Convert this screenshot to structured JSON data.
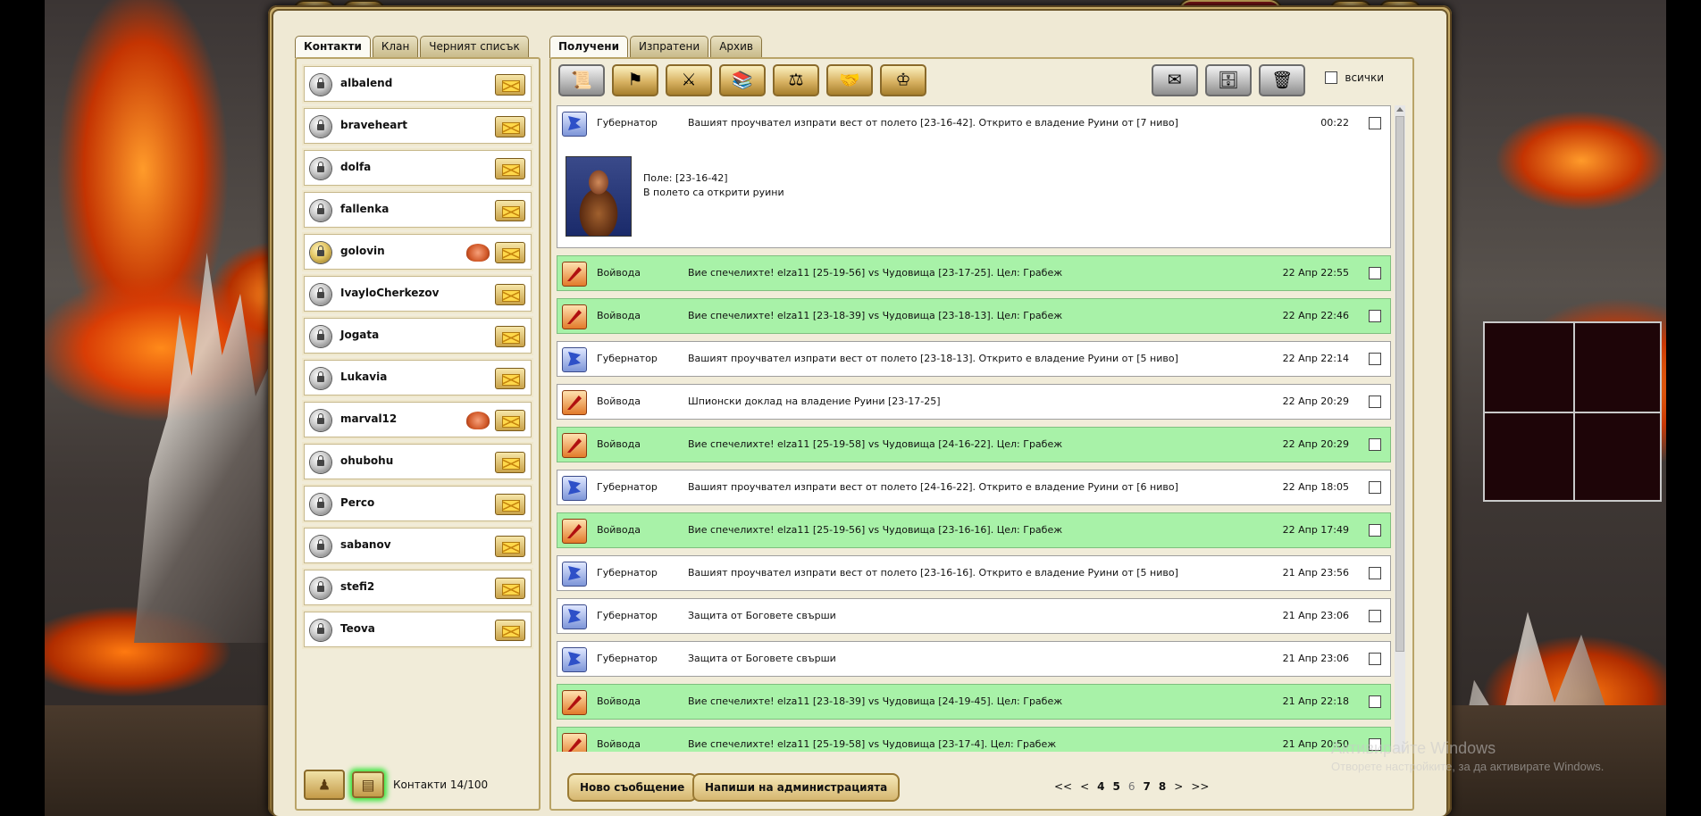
{
  "left_tabs": [
    "Контакти",
    "Клан",
    "Черният списък"
  ],
  "contacts": [
    {
      "name": "albalend",
      "clan": false,
      "gold": false
    },
    {
      "name": "braveheart",
      "clan": false,
      "gold": false
    },
    {
      "name": "dolfa",
      "clan": false,
      "gold": false
    },
    {
      "name": "fallenka",
      "clan": false,
      "gold": false
    },
    {
      "name": "golovin",
      "clan": true,
      "gold": true
    },
    {
      "name": "IvayloCherkezov",
      "clan": false,
      "gold": false
    },
    {
      "name": "Jogata",
      "clan": false,
      "gold": false
    },
    {
      "name": "Lukavia",
      "clan": false,
      "gold": false
    },
    {
      "name": "marval12",
      "clan": true,
      "gold": false
    },
    {
      "name": "ohubohu",
      "clan": false,
      "gold": false
    },
    {
      "name": "Perco",
      "clan": false,
      "gold": false
    },
    {
      "name": "sabanov",
      "clan": false,
      "gold": false
    },
    {
      "name": "stefi2",
      "clan": false,
      "gold": false
    },
    {
      "name": "Teova",
      "clan": false,
      "gold": false
    }
  ],
  "contacts_count": "Контакти 14/100",
  "right_tabs": [
    "Получени",
    "Изпратени",
    "Архив"
  ],
  "select_all_label": "всички",
  "messages": [
    {
      "type": "gov",
      "win": false,
      "sender": "Губернатор",
      "subject": "Вашият проучвател изпрати вест от полето [23-16-42]. Открито е владение Руини от [7 ниво]",
      "time": "00:22",
      "expanded": true,
      "body": [
        "Поле: [23-16-42]",
        "В полето са открити руини"
      ]
    },
    {
      "type": "war",
      "win": true,
      "sender": "Войвода",
      "subject": "Вие спечелихте! elza11 [25-19-56] vs Чудовища [23-17-25]. Цел: Грабеж",
      "time": "22 Апр 22:55"
    },
    {
      "type": "war",
      "win": true,
      "sender": "Войвода",
      "subject": "Вие спечелихте! elza11 [23-18-39] vs Чудовища [23-18-13]. Цел: Грабеж",
      "time": "22 Апр 22:46"
    },
    {
      "type": "gov",
      "win": false,
      "sender": "Губернатор",
      "subject": "Вашият проучвател изпрати вест от полето [23-18-13]. Открито е владение Руини от [5 ниво]",
      "time": "22 Апр 22:14"
    },
    {
      "type": "war",
      "win": false,
      "sender": "Войвода",
      "subject": "Шпионски доклад на владение Руини [23-17-25]",
      "time": "22 Апр 20:29"
    },
    {
      "type": "war",
      "win": true,
      "sender": "Войвода",
      "subject": "Вие спечелихте! elza11 [25-19-58] vs Чудовища [24-16-22]. Цел: Грабеж",
      "time": "22 Апр 20:29"
    },
    {
      "type": "gov",
      "win": false,
      "sender": "Губернатор",
      "subject": "Вашият проучвател изпрати вест от полето [24-16-22]. Открито е владение Руини от [6 ниво]",
      "time": "22 Апр 18:05"
    },
    {
      "type": "war",
      "win": true,
      "sender": "Войвода",
      "subject": "Вие спечелихте! elza11 [25-19-56] vs Чудовища [23-16-16]. Цел: Грабеж",
      "time": "22 Апр 17:49"
    },
    {
      "type": "gov",
      "win": false,
      "sender": "Губернатор",
      "subject": "Вашият проучвател изпрати вест от полето [23-16-16]. Открито е владение Руини от [5 ниво]",
      "time": "21 Апр 23:56"
    },
    {
      "type": "gov",
      "win": false,
      "sender": "Губернатор",
      "subject": "Защита от Боговете свърши",
      "time": "21 Апр 23:06"
    },
    {
      "type": "gov",
      "win": false,
      "sender": "Губернатор",
      "subject": "Защита от Боговете свърши",
      "time": "21 Апр 23:06"
    },
    {
      "type": "war",
      "win": true,
      "sender": "Войвода",
      "subject": "Вие спечелихте! elza11 [23-18-39] vs Чудовища [24-19-45]. Цел: Грабеж",
      "time": "21 Апр 22:18"
    },
    {
      "type": "war",
      "win": true,
      "sender": "Войвода",
      "subject": "Вие спечелихте! elza11 [25-19-58] vs Чудовища [23-17-4]. Цел: Грабеж",
      "time": "21 Апр 20:50"
    }
  ],
  "toolbar_icons": [
    "scroll-icon",
    "governor-icon",
    "warlord-icon",
    "library-icon",
    "merchant-icon",
    "handshake-icon",
    "advisor-icon"
  ],
  "toolbar_right_icons": [
    "envelope-icon",
    "archive-icon",
    "trash-icon"
  ],
  "new_message_label": "Ново съобщение",
  "write_admin_label": "Напиши на администрацията",
  "pager": [
    {
      "label": "<<",
      "cls": ""
    },
    {
      "label": "<",
      "cls": ""
    },
    {
      "label": "4",
      "cls": "bold"
    },
    {
      "label": "5",
      "cls": "bold"
    },
    {
      "label": "6",
      "cls": "cur"
    },
    {
      "label": "7",
      "cls": "bold"
    },
    {
      "label": "8",
      "cls": "bold"
    },
    {
      "label": ">",
      "cls": ""
    },
    {
      "label": ">>",
      "cls": ""
    }
  ],
  "watermark": {
    "line1": "Активирайте Windows",
    "line2": "Отворете настройките, за да активирате Windows."
  }
}
